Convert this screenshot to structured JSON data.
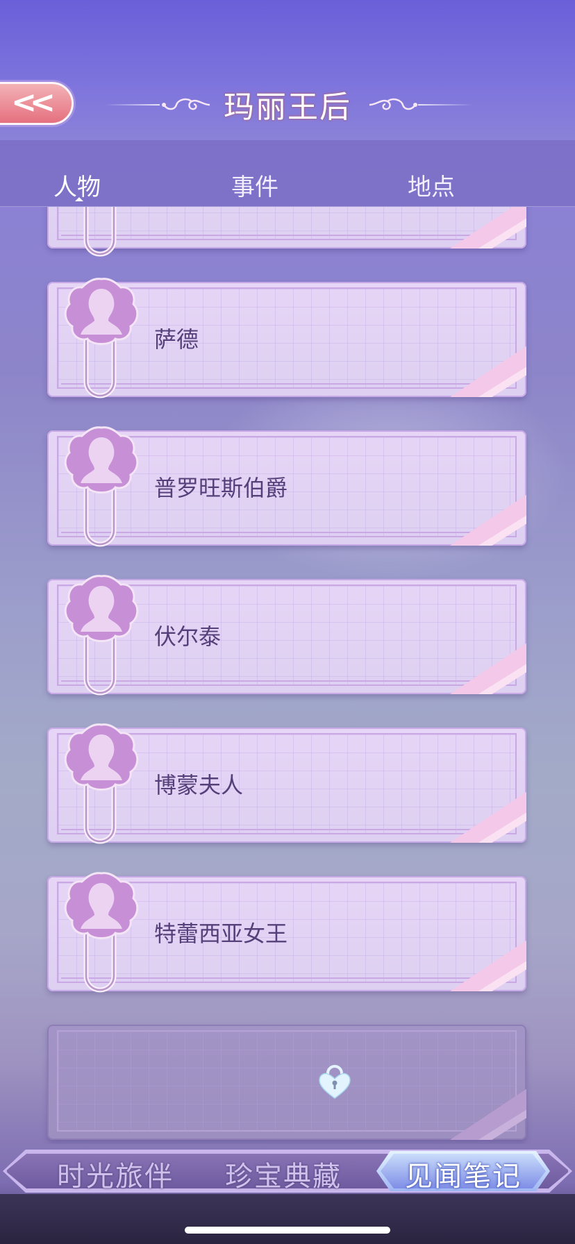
{
  "header": {
    "title": "玛丽王后",
    "back_icon": "double-chevron-left-icon"
  },
  "tabs": [
    {
      "label": "人物",
      "active": true
    },
    {
      "label": "事件",
      "active": false
    },
    {
      "label": "地点",
      "active": false
    }
  ],
  "characters": [
    {
      "name": "萨德"
    },
    {
      "name": "普罗旺斯伯爵"
    },
    {
      "name": "伏尔泰"
    },
    {
      "name": "博蒙夫人"
    },
    {
      "name": "特蕾西亚女王"
    }
  ],
  "locked_card": {
    "icon": "heart-lock-icon"
  },
  "bottom_nav": {
    "items": [
      "时光旅伴",
      "珍宝典藏"
    ],
    "active": "见闻笔记"
  },
  "colors": {
    "header": "#7e74dd",
    "card": "#e7d5f6",
    "name_text": "#55407a",
    "back_button": "#e5707f"
  }
}
